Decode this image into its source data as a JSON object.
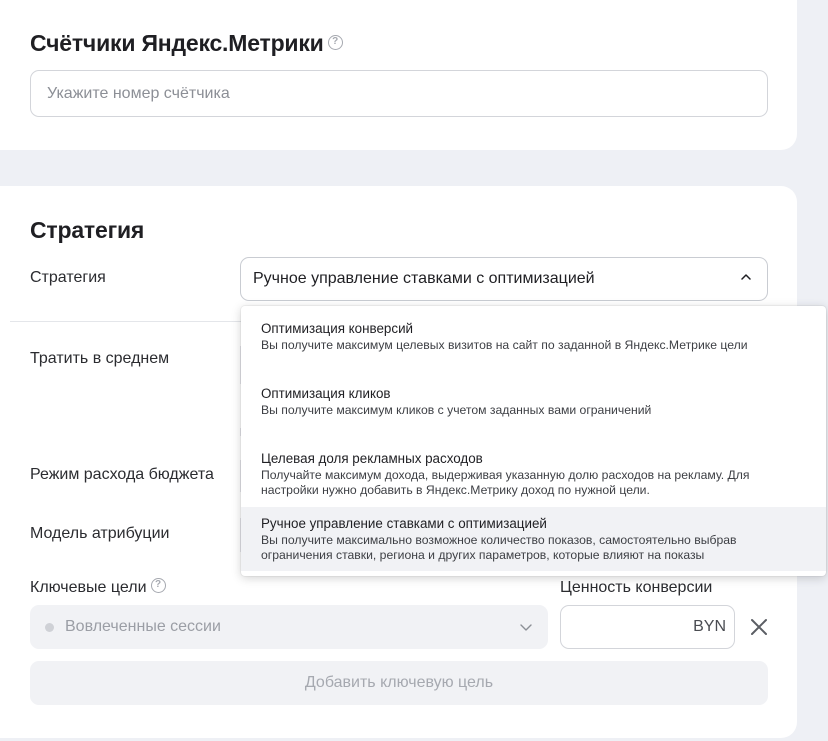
{
  "metrika": {
    "title": "Счётчики Яндекс.Метрики",
    "help_icon": "?",
    "counter_placeholder": "Укажите номер счётчика"
  },
  "strategy": {
    "title": "Стратегия",
    "field_label": "Стратегия",
    "selected": "Ручное управление ставками с оптимизацией",
    "options": [
      {
        "title": "Оптимизация конверсий",
        "desc": "Вы получите максимум целевых визитов на сайт по заданной в Яндекс.Метрике цели"
      },
      {
        "title": "Оптимизация кликов",
        "desc": "Вы получите максимум кликов с учетом заданных вами ограничений"
      },
      {
        "title": "Целевая доля рекламных расходов",
        "desc": "Получайте максимум дохода, выдерживая указанную долю расходов на рекламу. Для настройки нужно добавить в Яндекс.Метрику доход по нужной цели."
      },
      {
        "title": "Ручное управление ставками с оптимизацией",
        "desc": "Вы получите максимально возможное количество показов, самостоятельно выбрав ограничения ставки, региона и других параметров, которые влияют на показы"
      }
    ]
  },
  "labels": {
    "spend_avg": "Тратить в среднем",
    "budget_mode": "Режим расхода бюджета",
    "attribution": "Модель атрибуции"
  },
  "key_goals": {
    "label": "Ключевые цели",
    "help_icon": "?",
    "selected_goal": "Вовлеченные сессии",
    "conversion_value_label": "Ценность конверсии",
    "currency": "BYN",
    "add_button": "Добавить ключевую цель"
  },
  "colors": {
    "accent_text": "#1f1f23",
    "muted": "#a6a9b0",
    "selected_option_bg": "#f1f2f5"
  },
  "icons": {
    "chevron_up": "chevron-up-icon",
    "chevron_down": "chevron-down-icon",
    "close": "close-icon",
    "help": "help-circle-icon"
  }
}
